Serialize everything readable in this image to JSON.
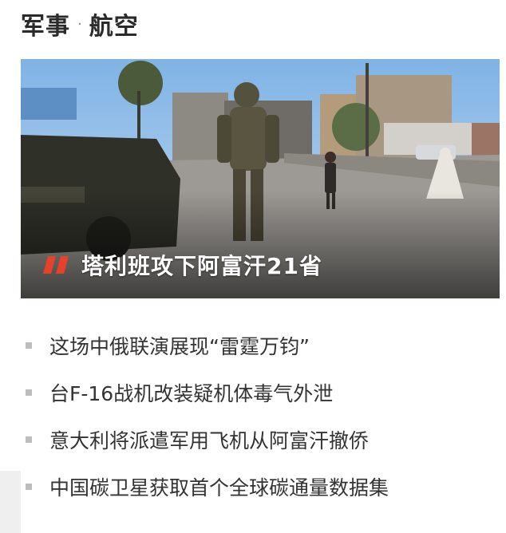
{
  "header": {
    "category": "军事",
    "subcategory": "航空"
  },
  "hero": {
    "title": "塔利班攻下阿富汗21省",
    "accent_color": "#e8412b"
  },
  "news": [
    {
      "title": "这场中俄联演展现“雷霆万钧”"
    },
    {
      "title": "台F-16战机改装疑机体毒气外泄"
    },
    {
      "title": "意大利将派遣军用飞机从阿富汗撤侨"
    },
    {
      "title": "中国碳卫星获取首个全球碳通量数据集"
    }
  ]
}
